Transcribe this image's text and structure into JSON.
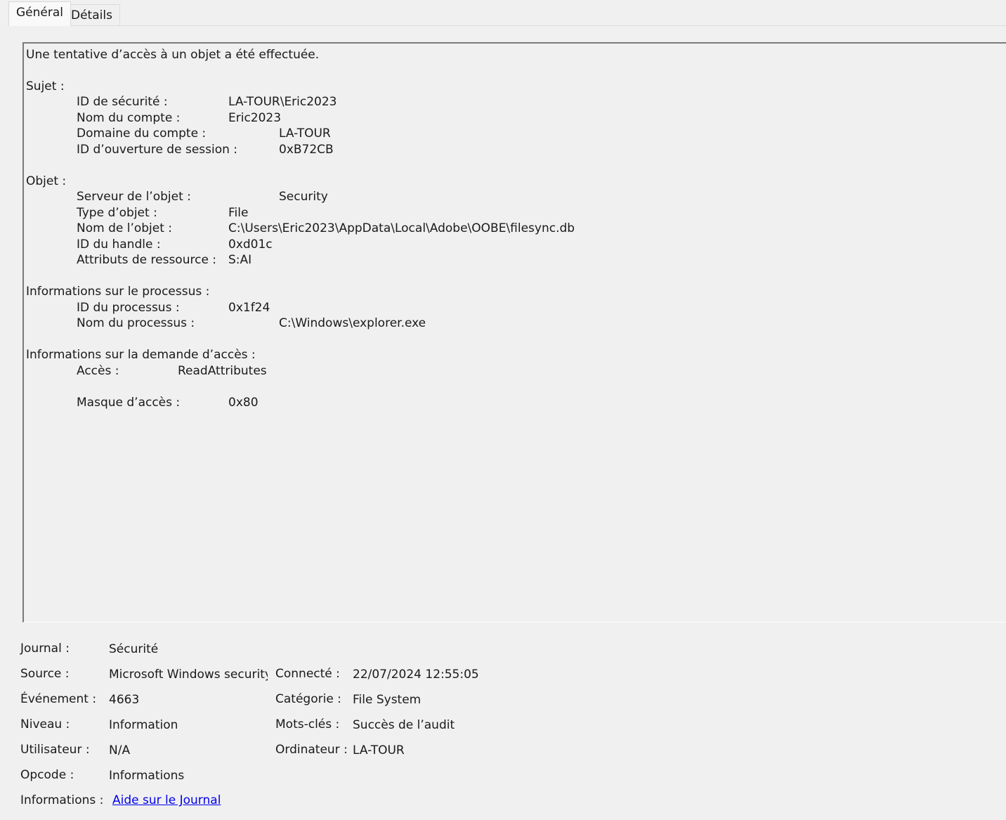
{
  "tabs": [
    {
      "label": "Général",
      "active": true
    },
    {
      "label": "Détails",
      "active": false
    }
  ],
  "description": {
    "headline": "Une tentative d’accès à un objet a été effectuée.",
    "subject": {
      "header": "Sujet :",
      "security_id_label": "ID de sécurité :",
      "security_id_value": "LA-TOUR\\Eric2023",
      "account_name_label": "Nom du compte :",
      "account_name_value": "Eric2023",
      "account_domain_label": "Domaine du compte :",
      "account_domain_value": "LA-TOUR",
      "logon_id_label": "ID d’ouverture de session :",
      "logon_id_value": "0xB72CB"
    },
    "object": {
      "header": "Objet :",
      "server_label": "Serveur de l’objet :",
      "server_value": "Security",
      "type_label": "Type d’objet :",
      "type_value": "File",
      "name_label": "Nom de l’objet :",
      "name_value": "C:\\Users\\Eric2023\\AppData\\Local\\Adobe\\OOBE\\filesync.db",
      "handle_label": "ID du handle :",
      "handle_value": "0xd01c",
      "attributes_label": "Attributs de ressource :",
      "attributes_value": "S:AI"
    },
    "process": {
      "header": "Informations sur le processus :",
      "pid_label": "ID du processus :",
      "pid_value": "0x1f24",
      "name_label": "Nom du processus :",
      "name_value": "C:\\Windows\\explorer.exe"
    },
    "access": {
      "header": "Informations sur la demande d’accès :",
      "accesses_label": "Accès :",
      "accesses_value": "ReadAttributes",
      "mask_label": "Masque d’accès :",
      "mask_value": "0x80"
    }
  },
  "properties": {
    "log_label": "Journal :",
    "log_value": "Sécurité",
    "source_label": "Source :",
    "source_value": "Microsoft Windows security a",
    "logged_label": "Connecté :",
    "logged_value": "22/07/2024 12:55:05",
    "event_label": "Événement :",
    "event_value": "4663",
    "category_label": "Catégorie :",
    "category_value": "File System",
    "level_label": "Niveau :",
    "level_value": "Information",
    "keywords_label": "Mots-clés :",
    "keywords_value": "Succès de l’audit",
    "user_label": "Utilisateur :",
    "user_value": "N/A",
    "computer_label": "Ordinateur :",
    "computer_value": "LA-TOUR",
    "opcode_label": "Opcode :",
    "opcode_value": "Informations",
    "more_info_label": "Informations :",
    "more_info_link": "Aide sur le Journal"
  },
  "colors": {
    "background": "#f0f0f0",
    "link": "#0000ee",
    "border_dark": "#7a7a7a"
  }
}
